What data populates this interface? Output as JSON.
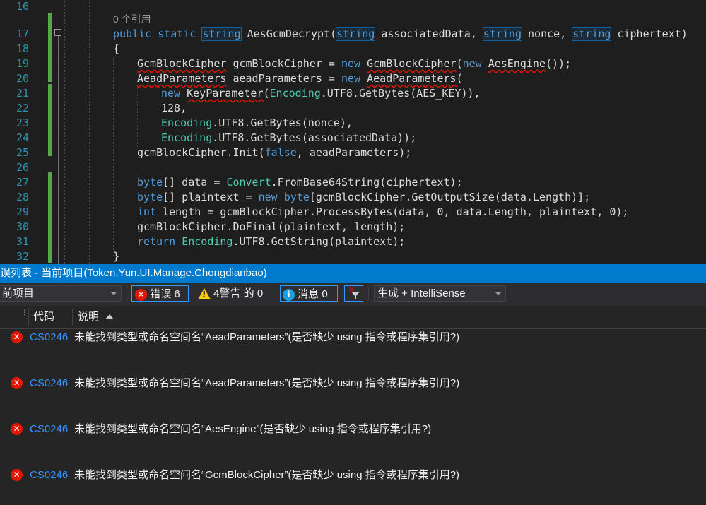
{
  "editor": {
    "line_numbers": [
      "16",
      "17",
      "18",
      "19",
      "20",
      "21",
      "22",
      "23",
      "24",
      "25",
      "26",
      "27",
      "28",
      "29",
      "30",
      "31",
      "32"
    ],
    "codelens": "0 个引用",
    "tokens": {
      "public": "public",
      "static": "static",
      "string": "string",
      "method": "AesGcmDecrypt",
      "associatedData": "associatedData",
      "nonce": "nonce",
      "ciphertext": "ciphertext",
      "open_brace": "{",
      "close_brace": "}",
      "GcmBlockCipher": "GcmBlockCipher",
      "gcmBlockCipher": "gcmBlockCipher",
      "new": "new",
      "AesEngine": "AesEngine",
      "AeadParameters": "AeadParameters",
      "aeadParameters": "aeadParameters",
      "KeyParameter": "KeyParameter",
      "Encoding": "Encoding",
      "UTF8GetBytes": ".UTF8.GetBytes",
      "AES_KEY": "AES_KEY",
      "n128": "128",
      "Init": ".Init",
      "false": "false",
      "byte": "byte",
      "data": "data",
      "Convert": "Convert",
      "FromBase64String": ".FromBase64String",
      "plaintext": "plaintext",
      "GetOutputSize": ".GetOutputSize",
      "dataLength": "data.Length",
      "int": "int",
      "length": "length",
      "ProcessBytes": ".ProcessBytes",
      "zero": "0",
      "DoFinal": ".DoFinal",
      "return": "return",
      "UTF8GetString": ".UTF8.GetString"
    }
  },
  "error_list": {
    "title": "误列表 - 当前项目(Token.Yun.UI.Manage.Chongdianbao)",
    "scope_select": "前项目",
    "errors_filter": "错误 6",
    "warnings_filter": "4警告 的 0",
    "messages_filter": "消息 0",
    "build_select": "生成 + IntelliSense",
    "columns": {
      "code": "代码",
      "description": "说明"
    },
    "rows": [
      {
        "code": "CS0246",
        "description": "未能找到类型或命名空间名“AeadParameters”(是否缺少 using 指令或程序集引用?)"
      },
      {
        "code": "CS0246",
        "description": "未能找到类型或命名空间名“AeadParameters”(是否缺少 using 指令或程序集引用?)"
      },
      {
        "code": "CS0246",
        "description": "未能找到类型或命名空间名“AesEngine”(是否缺少 using 指令或程序集引用?)"
      },
      {
        "code": "CS0246",
        "description": "未能找到类型或命名空间名“GcmBlockCipher”(是否缺少 using 指令或程序集引用?)"
      }
    ]
  },
  "colors": {
    "editor_bg": "#1e1e1e",
    "keyword": "#569cd6",
    "type": "#4ec9b0",
    "line_number": "#2b91af",
    "panel_title_bg": "#007acc",
    "error_code": "#3794ff",
    "error_icon": "#e51400",
    "change_bar": "#57a64a"
  },
  "icons": [
    "collapse-icon",
    "error-icon",
    "warning-icon",
    "info-icon",
    "filter-clear-icon",
    "sort-ascending-icon",
    "dropdown-arrow-icon"
  ]
}
